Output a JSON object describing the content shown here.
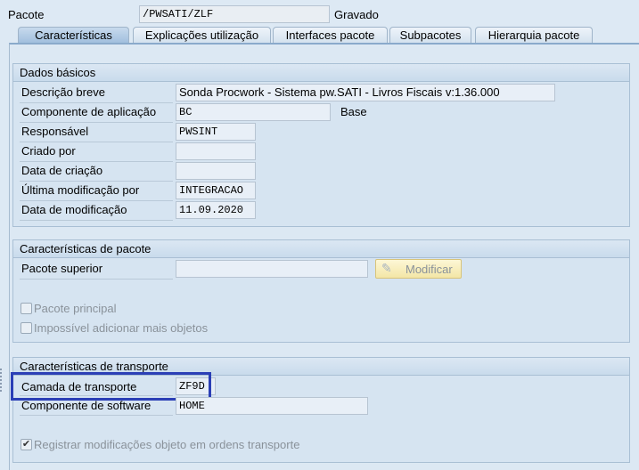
{
  "header": {
    "package_label": "Pacote",
    "package_value": "/PWSATI/ZLF",
    "status": "Gravado"
  },
  "tabs": [
    {
      "label": "Características"
    },
    {
      "label": "Explicações utilização"
    },
    {
      "label": "Interfaces pacote"
    },
    {
      "label": "Subpacotes"
    },
    {
      "label": "Hierarquia pacote"
    }
  ],
  "basic": {
    "title": "Dados básicos",
    "fields": [
      {
        "label": "Descrição breve",
        "value": "Sonda Procwork - Sistema pw.SATI - Livros Fiscais v:1.36.000"
      },
      {
        "label": "Componente de aplicação",
        "value": "BC",
        "extra": "Base"
      },
      {
        "label": "Responsável",
        "value": "PWSINT"
      },
      {
        "label": "Criado por",
        "value": ""
      },
      {
        "label": "Data de criação",
        "value": ""
      },
      {
        "label": "Última modificação por",
        "value": "INTEGRACAO"
      },
      {
        "label": "Data de modificação",
        "value": "11.09.2020"
      }
    ]
  },
  "pkg": {
    "title": "Características de pacote",
    "superior_label": "Pacote superior",
    "superior_value": "",
    "modify_button": "Modificar",
    "main_pkg": "Pacote principal",
    "no_more": "Impossível adicionar mais objetos"
  },
  "transport": {
    "title": "Características de transporte",
    "layer_label": "Camada de transporte",
    "layer_value": "ZF9D",
    "sw_label": "Componente de software",
    "sw_value": "HOME",
    "record": "Registrar modificações objeto em ordens transporte",
    "highlight_color": "#2b3fb6"
  }
}
